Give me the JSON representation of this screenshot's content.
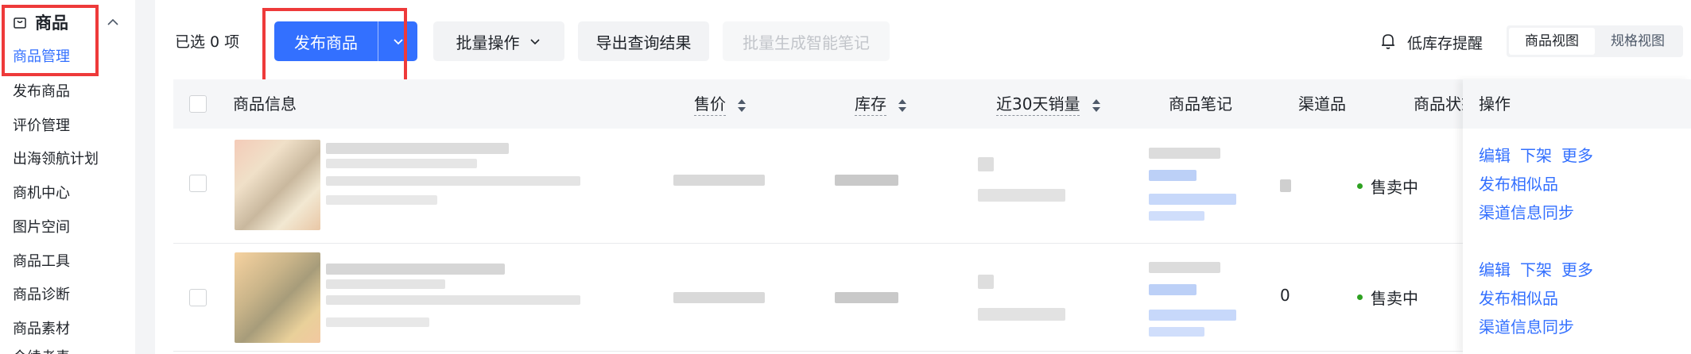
{
  "sidebar": {
    "section_title": "商品",
    "items": [
      {
        "label": "商品管理",
        "active": true
      },
      {
        "label": "发布商品"
      },
      {
        "label": "评价管理"
      },
      {
        "label": "出海领航计划"
      },
      {
        "label": "商机中心"
      },
      {
        "label": "图片空间"
      },
      {
        "label": "商品工具"
      },
      {
        "label": "商品诊断"
      },
      {
        "label": "商品素材"
      },
      {
        "label": "今续考毒"
      }
    ]
  },
  "toolbar": {
    "selected_text": "已选 0 项",
    "publish_label": "发布商品",
    "batch_label": "批量操作",
    "export_label": "导出查询结果",
    "smart_notes_label": "批量生成智能笔记",
    "low_stock_label": "低库存提醒",
    "view_options": [
      "商品视图",
      "规格视图"
    ]
  },
  "table": {
    "headers": {
      "info": "商品信息",
      "price": "售价",
      "stock": "库存",
      "sales30": "近30天销量",
      "notes": "商品笔记",
      "channel": "渠道品",
      "status": "商品状态",
      "ops": "操作"
    },
    "rows": [
      {
        "channel": "",
        "status": "售卖中",
        "ops": [
          "编辑",
          "下架",
          "更多"
        ],
        "op_similar": "发布相似品",
        "op_sync": "渠道信息同步"
      },
      {
        "channel": "0",
        "status": "售卖中",
        "ops": [
          "编辑",
          "下架",
          "更多"
        ],
        "op_similar": "发布相似品",
        "op_sync": "渠道信息同步"
      }
    ]
  },
  "colors": {
    "accent": "#3370ff",
    "highlight": "#ee3a3a",
    "status_green": "#2ea121"
  }
}
